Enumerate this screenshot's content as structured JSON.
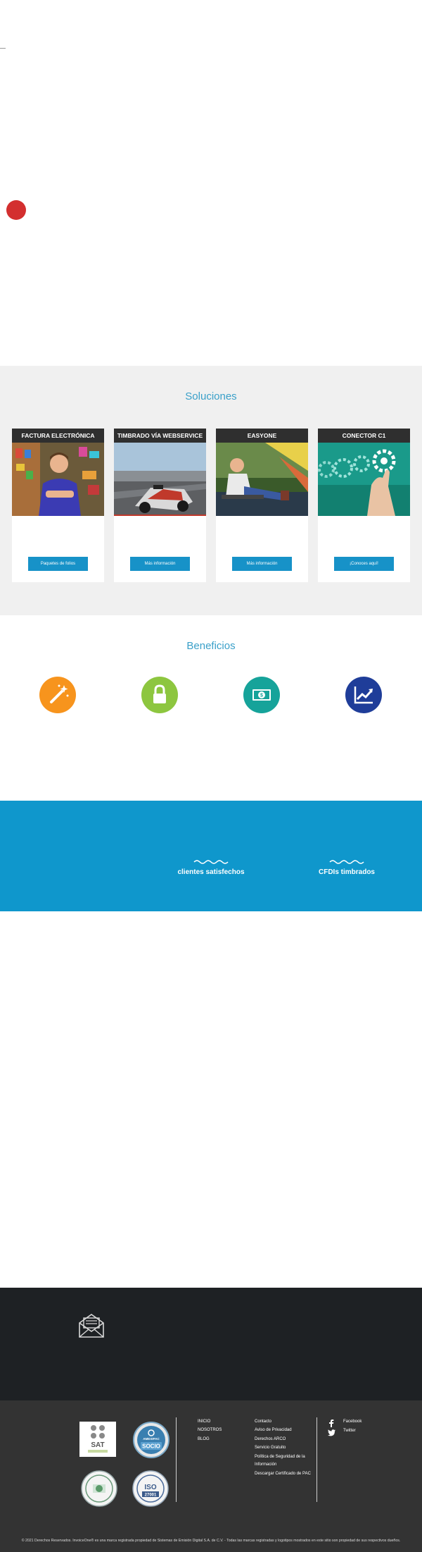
{
  "soluciones": {
    "title": "Soluciones",
    "cards": [
      {
        "title": "FACTURA ELECTRÓNICA",
        "button": "Paquetes de folios"
      },
      {
        "title": "TIMBRADO VÍA WEBSERVICE",
        "button": "Más información"
      },
      {
        "title": "EASYONE",
        "button": "Más información"
      },
      {
        "title": "CONECTOR C1",
        "button": "¡Conoces aquí!"
      }
    ]
  },
  "beneficios": {
    "title": "Beneficios",
    "icons": [
      {
        "icon": "magic-wand-icon",
        "color": "#f7941d"
      },
      {
        "icon": "lock-icon",
        "color": "#8dc63f"
      },
      {
        "icon": "money-icon",
        "color": "#16a39a"
      },
      {
        "icon": "chart-up-icon",
        "color": "#1f3d99"
      }
    ]
  },
  "stats": {
    "clients_label": "clientes satisfechos",
    "cfdis_label": "CFDIs timbrados"
  },
  "footer": {
    "logos": {
      "sat": "SAT",
      "amexipac": "AMEXIPAC",
      "amexipac_sub": "SOCIO",
      "iso": "ISO",
      "iso_sub": "27001"
    },
    "col1": [
      "INICIO",
      "NOSOTROS",
      "BLOG"
    ],
    "col2": [
      "Contacto",
      "Aviso de Privacidad",
      "Derechos ARCO",
      "Servicio Gratuito",
      "Política de Seguridad de la",
      "Información",
      "Descargar Certificado de PAC"
    ],
    "social": [
      "Facebook",
      "Twitter"
    ],
    "copyright": "© 2021 Derechos Reservados. InvoiceOne® es una marca registrada propiedad de Sistemas de Emisión Digital S.A. de C.V. - Todas las marcas registradas y logotipos mostrados en este sitio son propiedad de sus respectivos dueños."
  }
}
